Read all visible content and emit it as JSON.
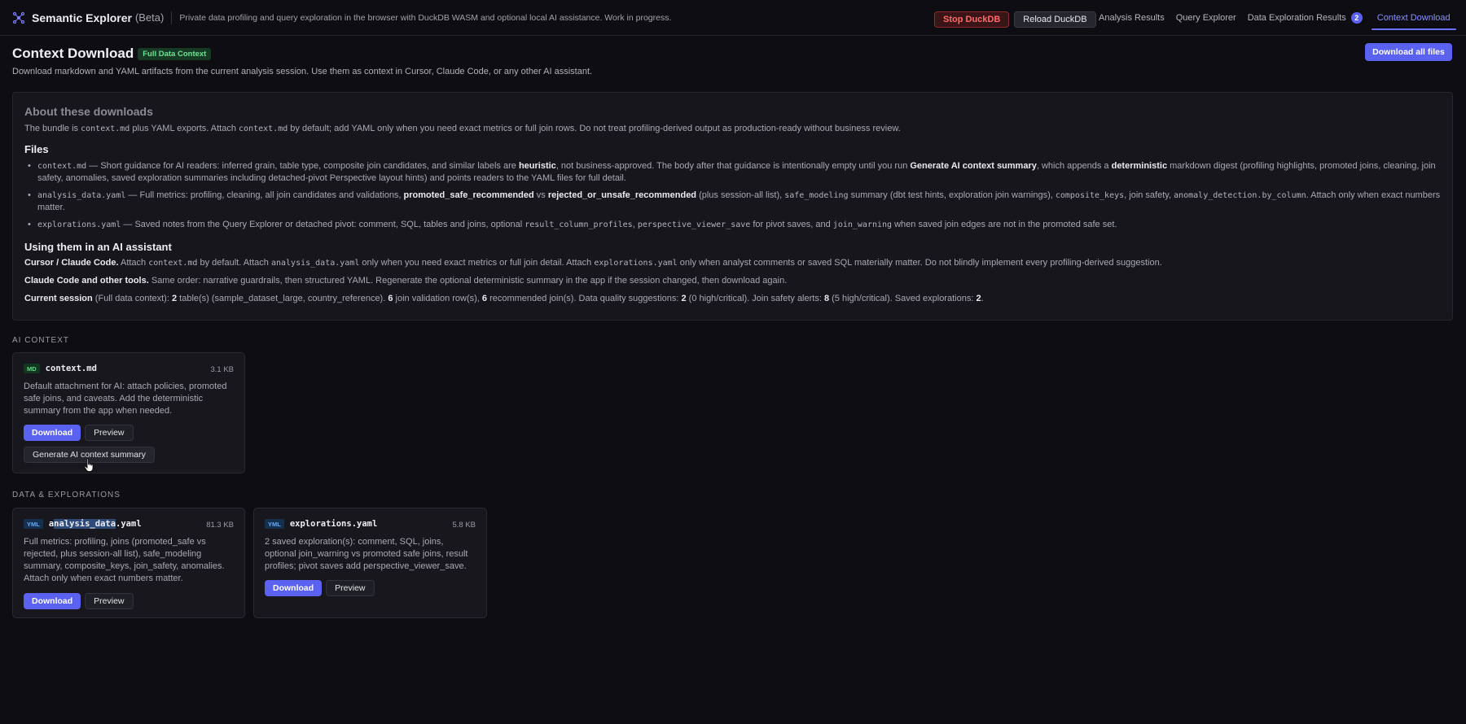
{
  "header": {
    "app_name": "Semantic Explorer",
    "app_badge": "(Beta)",
    "tagline": "Private data profiling and query exploration in the browser with DuckDB WASM and optional local AI assistance. Work in progress.",
    "stop_label": "Stop DuckDB",
    "reload_label": "Reload DuckDB",
    "nav": [
      {
        "label": "Analysis Results"
      },
      {
        "label": "Query Explorer"
      },
      {
        "label": "Data Exploration Results",
        "badge": "2"
      },
      {
        "label": "Context Download",
        "active": true
      }
    ]
  },
  "page": {
    "title": "Context Download",
    "badge": "Full Data Context",
    "description": "Download markdown and YAML artifacts from the current analysis session. Use them as context in Cursor, Claude Code, or any other AI assistant.",
    "download_all_label": "Download all files"
  },
  "about": {
    "title": "About these downloads",
    "intro": {
      "t1": "The bundle is ",
      "c1": "context.md",
      "t2": " plus YAML exports. Attach ",
      "c2": "context.md",
      "t3": " by default; add YAML only when you need exact metrics or full join rows. Do not treat profiling-derived output as production-ready without business review."
    },
    "files_heading": "Files",
    "file_items": {
      "context": {
        "code": "context.md",
        "t1": " — Short guidance for AI readers: inferred grain, table type, composite join candidates, and similar labels are ",
        "b1": "heuristic",
        "t2": ", not business-approved. The body after that guidance is intentionally empty until you run ",
        "b2": "Generate AI context summary",
        "t3": ", which appends a ",
        "b3": "deterministic",
        "t4": " markdown digest (profiling highlights, promoted joins, cleaning, join safety, anomalies, saved exploration summaries including detached-pivot Perspective layout hints) and points readers to the YAML files for full detail."
      },
      "analysis": {
        "code": "analysis_data.yaml",
        "t1": " — Full metrics: profiling, cleaning, all join candidates and validations, ",
        "b1": "promoted_safe_recommended",
        "t2": " vs ",
        "b2": "rejected_or_unsafe_recommended",
        "t3": " (plus session-all list), ",
        "c2": "safe_modeling",
        "t4": " summary (dbt test hints, exploration join warnings), ",
        "c3": "composite_keys",
        "t5": ", join safety, ",
        "c4": "anomaly_detection.by_column",
        "t6": ". Attach only when exact numbers matter."
      },
      "explorations": {
        "code": "explorations.yaml",
        "t1": " — Saved notes from the Query Explorer or detached pivot: comment, SQL, tables and joins, optional ",
        "c2": "result_column_profiles",
        "t2": ", ",
        "c3": "perspective_viewer_save",
        "t3": " for pivot saves, and ",
        "c4": "join_warning",
        "t4": " when saved join edges are not in the promoted safe set."
      }
    },
    "usage_heading": "Using them in an AI assistant",
    "usage_cursor": {
      "b": "Cursor / Claude Code.",
      "t1": " Attach ",
      "c1": "context.md",
      "t2": " by default. Attach ",
      "c2": "analysis_data.yaml",
      "t3": " only when you need exact metrics or full join detail. Attach ",
      "c3": "explorations.yaml",
      "t4": " only when analyst comments or saved SQL materially matter. Do not blindly implement every profiling-derived suggestion."
    },
    "usage_claude": {
      "b": "Claude Code and other tools.",
      "t": " Same order: narrative guardrails, then structured YAML. Regenerate the optional deterministic summary in the app if the session changed, then download again."
    },
    "session": {
      "label": "Current session",
      "t1": " (Full data context): ",
      "n1": "2",
      "t2": " table(s) (sample_dataset_large, country_reference). ",
      "n2": "6",
      "t3": " join validation row(s), ",
      "n3": "6",
      "t4": " recommended join(s). Data quality suggestions: ",
      "n4": "2",
      "t5": " (0 high/critical). Join safety alerts: ",
      "n5": "8",
      "t6": " (5 high/critical). Saved explorations: ",
      "n6": "2",
      "t7": "."
    }
  },
  "sections": {
    "ai_context": "AI CONTEXT",
    "data_explorations": "DATA & EXPLORATIONS"
  },
  "cards": {
    "context": {
      "tag": "MD",
      "name": "context.md",
      "size": "3.1 KB",
      "desc": [
        "Default attachment for AI: attach policies, promoted",
        "safe joins, and caveats. Add the deterministic",
        "summary from the app when needed."
      ],
      "download": "Download",
      "preview": "Preview",
      "generate": "Generate AI context summary"
    },
    "analysis": {
      "tag": "YML",
      "name_pre": "a",
      "name_hl": "nalysis_data",
      "name_post": ".yaml",
      "size": "81.3 KB",
      "desc": [
        "Full metrics: profiling, joins (promoted_safe vs",
        "rejected, plus session-all list), safe_modeling",
        "summary, composite_keys, join_safety, anomalies.",
        "Attach only when exact numbers matter."
      ],
      "download": "Download",
      "preview": "Preview"
    },
    "explorations": {
      "tag": "YML",
      "name": "explorations.yaml",
      "size": "5.8 KB",
      "desc": [
        "2 saved exploration(s): comment, SQL, joins,",
        "optional join_warning vs promoted safe joins, result",
        "profiles; pivot saves add perspective_viewer_save."
      ],
      "download": "Download",
      "preview": "Preview"
    }
  }
}
